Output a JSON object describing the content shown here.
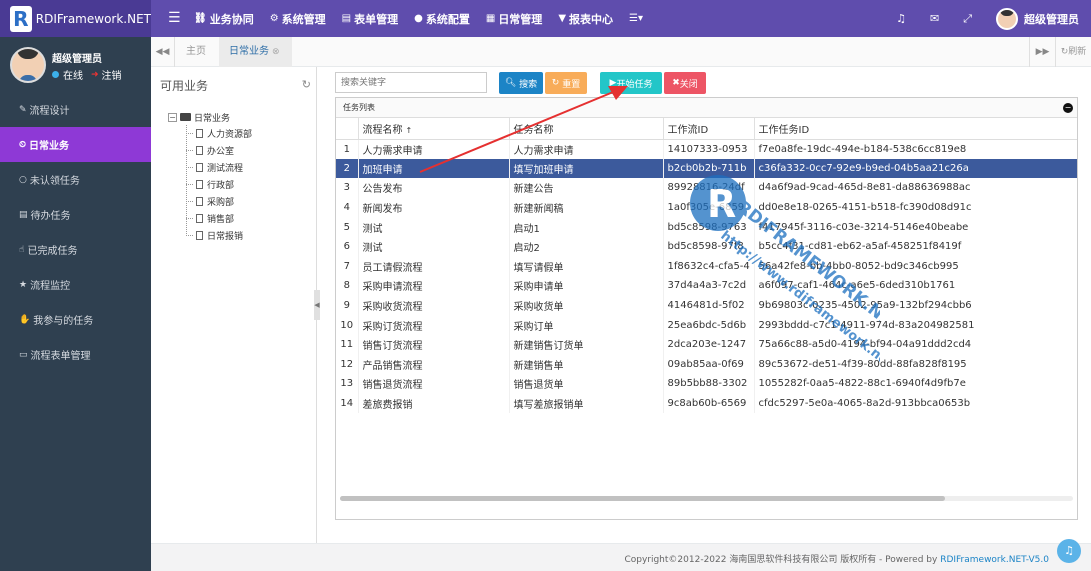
{
  "brand": {
    "name": "RDIFramework.NET",
    "logo_letter": "R"
  },
  "topnav": {
    "menu_icon": "menu-icon",
    "items": [
      {
        "label": "业务协同",
        "icon": "sitemap-icon",
        "glyph": "⛓"
      },
      {
        "label": "系统管理",
        "icon": "gears-icon",
        "glyph": "⚙"
      },
      {
        "label": "表单管理",
        "icon": "table-icon",
        "glyph": "▤"
      },
      {
        "label": "系统配置",
        "icon": "circle-icon",
        "glyph": "●"
      },
      {
        "label": "日常管理",
        "icon": "calendar-icon",
        "glyph": "▦"
      },
      {
        "label": "报表中心",
        "icon": "filter-icon",
        "glyph": "▼"
      },
      {
        "label": "",
        "icon": "more-menu-icon",
        "glyph": "☰▾"
      }
    ],
    "right_icons": [
      {
        "name": "bell-icon",
        "glyph": "🔔"
      },
      {
        "name": "mail-icon",
        "glyph": "✉"
      },
      {
        "name": "expand-icon",
        "glyph": "⤢"
      }
    ],
    "user_name": "超级管理员"
  },
  "sidebar": {
    "user_name": "超级管理员",
    "status": "在线",
    "logout": "注销",
    "items": [
      {
        "label": "流程设计",
        "icon": "design-icon",
        "glyph": "✎",
        "active": false
      },
      {
        "label": "日常业务",
        "icon": "clock-icon",
        "glyph": "⏲",
        "active": true
      },
      {
        "label": "未认领任务",
        "icon": "circle-o-icon",
        "glyph": "○",
        "active": false
      },
      {
        "label": "待办任务",
        "icon": "list-icon",
        "glyph": "▤",
        "active": false
      },
      {
        "label": "已完成任务",
        "icon": "thumbs-up-icon",
        "glyph": "☝",
        "active": false
      },
      {
        "label": "流程监控",
        "icon": "star-icon",
        "glyph": "★",
        "active": false
      },
      {
        "label": "我参与的任务",
        "icon": "hand-icon",
        "glyph": "✋",
        "active": false
      },
      {
        "label": "流程表单管理",
        "icon": "desktop-icon",
        "glyph": "▭",
        "active": false
      }
    ]
  },
  "tabs": {
    "home": "主页",
    "current": "日常业务",
    "refresh": "刷新"
  },
  "business_panel": {
    "title": "可用业务",
    "root": "日常业务",
    "children": [
      "人力资源部",
      "办公室",
      "测试流程",
      "行政部",
      "采购部",
      "销售部",
      "日常报销"
    ]
  },
  "toolbar": {
    "search_placeholder": "搜索关键字",
    "search_label": "搜索",
    "reset_label": "重置",
    "start_label": "开始任务",
    "close_label": "关闭"
  },
  "grid": {
    "caption": "任务列表",
    "columns": [
      "流程名称",
      "任务名称",
      "工作流ID",
      "工作任务ID"
    ],
    "sort_indicator": "↑",
    "selected_row": 2,
    "rows": [
      [
        "1",
        "人力需求申请",
        "人力需求申请",
        "14107333-0953",
        "f7e0a8fe-19dc-494e-b184-538c6cc819e8"
      ],
      [
        "2",
        "加班申请",
        "填写加班申请",
        "b2cb0b2b-711b",
        "c36fa332-0cc7-92e9-b9ed-04b5aa21c26a"
      ],
      [
        "3",
        "公告发布",
        "新建公告",
        "89928816-24df",
        "d4a6f9ad-9cad-465d-8e81-da88636988ac"
      ],
      [
        "4",
        "新闻发布",
        "新建新闻稿",
        "1a0f305e-6859",
        "dd0e8e18-0265-4151-b518-fc390d08d91c"
      ],
      [
        "5",
        "测试",
        "启动1",
        "bd5c8598-9763",
        "f417945f-3116-c03e-3214-5146e40beabe"
      ],
      [
        "6",
        "测试",
        "启动2",
        "bd5c8598-97f8",
        "b5cc4f31-cd81-eb62-a5af-458251f8419f"
      ],
      [
        "7",
        "员工请假流程",
        "填写请假单",
        "1f8632c4-cfa5-4",
        "56a42fe8-bb-4bb0-8052-bd9c346cb995"
      ],
      [
        "8",
        "采购申请流程",
        "采购申请单",
        "37d4a4a3-7c2d",
        "a6f097-caf1-464c-a6e5-6ded310b1761"
      ],
      [
        "9",
        "采购收货流程",
        "采购收货单",
        "4146481d-5f02",
        "9b69803c-0235-4502-95a9-132bf294cbb6"
      ],
      [
        "10",
        "采购订货流程",
        "采购订单",
        "25ea6bdc-5d6b",
        "2993bddd-c7c1-4911-974d-83a204982581"
      ],
      [
        "11",
        "销售订货流程",
        "新建销售订货单",
        "2dca203e-1247",
        "75a66c88-a5d0-4194-bf94-04a91ddd2cd4"
      ],
      [
        "12",
        "产品销售流程",
        "新建销售单",
        "09ab85aa-0f69",
        "89c53672-de51-4f39-80dd-88fa828f8195"
      ],
      [
        "13",
        "销售退货流程",
        "销售退货单",
        "89b5bb88-3302",
        "1055282f-0aa5-4822-88c1-6940f4d9fb7e"
      ],
      [
        "14",
        "差旅费报销",
        "填写差旅报销单",
        "9c8ab60b-6569",
        "cfdc5297-5e0a-4065-8a2d-913bbca0653b"
      ]
    ]
  },
  "footer": {
    "copyright": "Copyright©2012-2022 海南国思软件科技有限公司 版权所有 - Powered by ",
    "powered_link": "RDIFramework.NET-V5.0"
  },
  "watermark": {
    "text": "http://www.rdiframework.net",
    "big": "RDIFRAMEWORK.NET"
  },
  "colors": {
    "header": "#5f4dad",
    "sidebar": "#2f4050",
    "active": "#8e39d6",
    "selected_row": "#3c5a9c",
    "arrow": "#e53030"
  }
}
